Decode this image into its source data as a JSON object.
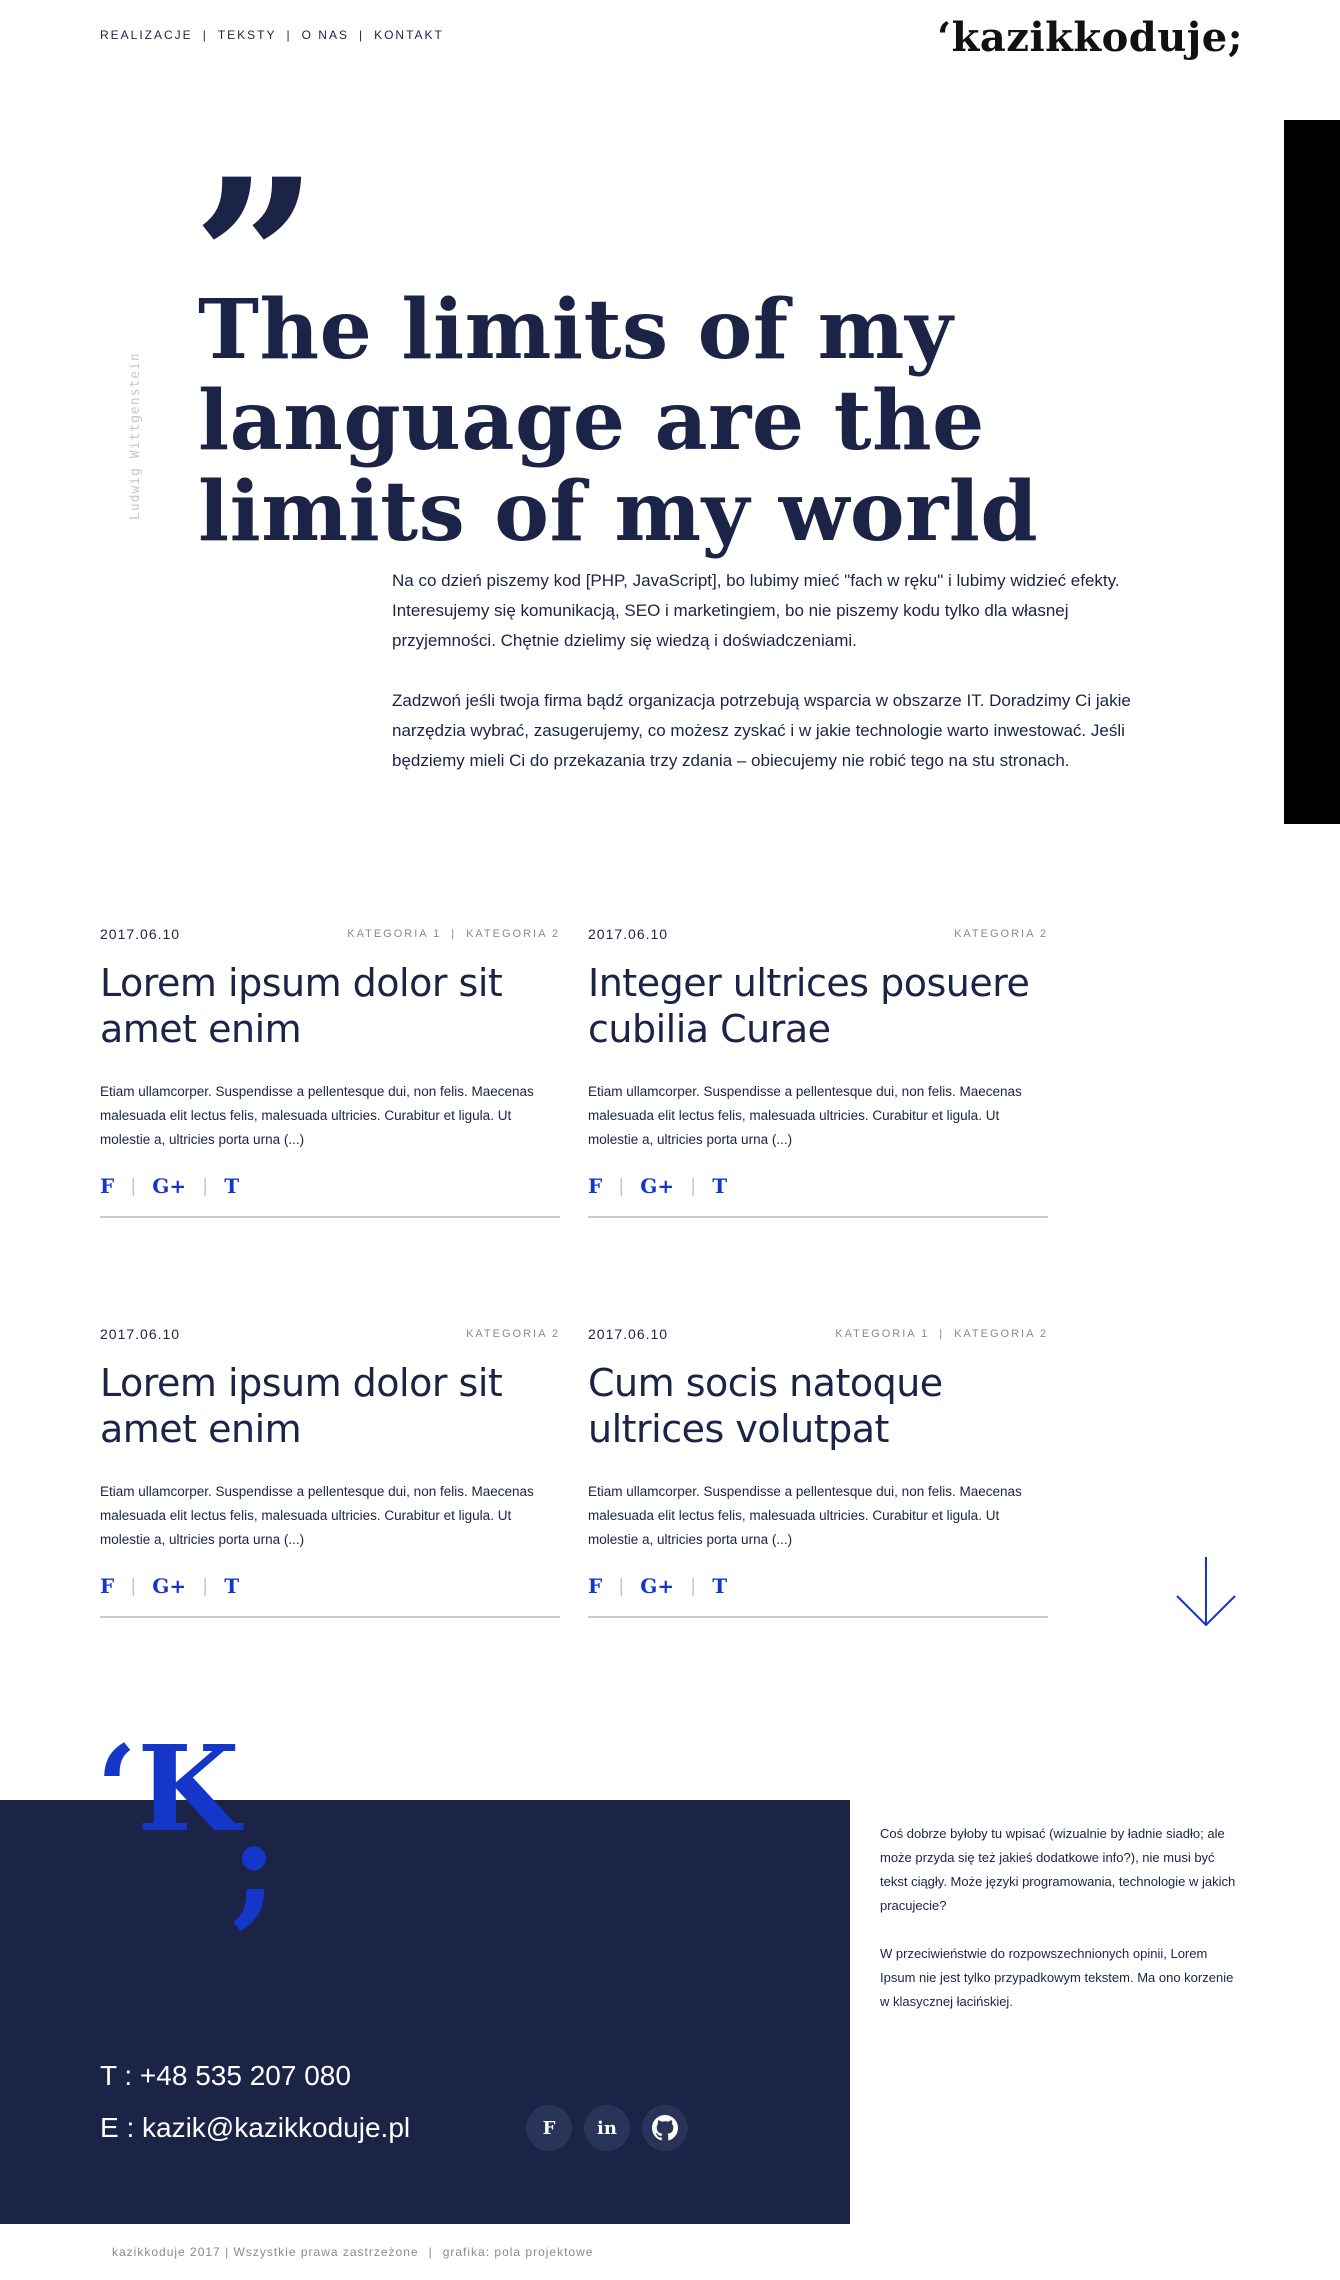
{
  "nav": {
    "items": [
      "REALIZACJE",
      "TEKSTY",
      "O NAS",
      "KONTAKT"
    ]
  },
  "logo": "‘kazikkoduje;",
  "hero": {
    "quote_mark": "”",
    "title": "The limits of my language are the limits of my world",
    "author": "Ludwig Wittgenstein",
    "paragraphs": [
      "Na co dzień piszemy kod [PHP, JavaScript], bo lubimy mieć \"fach w ręku\" i lubimy widzieć efekty. Interesujemy się komunikacją, SEO i marketingiem, bo nie piszemy kodu tylko dla własnej przyjemności. Chętnie dzielimy się wiedzą i doświadczeniami.",
      "Zadzwoń jeśli twoja firma bądź organizacja potrzebują wsparcia w obszarze IT. Doradzimy Ci jakie narzędzia wybrać, zasugerujemy, co możesz zyskać i w jakie technologie warto inwestować. Jeśli będziemy mieli Ci do przekazania trzy zdania – obiecujemy nie robić tego na stu stronach."
    ]
  },
  "articles": [
    {
      "date": "2017.06.10",
      "categories": [
        "KATEGORIA 1",
        "KATEGORIA 2"
      ],
      "title": "Lorem ipsum dolor sit amet enim",
      "excerpt": "Etiam ullamcorper. Suspendisse a pellentesque dui, non felis. Maecenas malesuada elit lectus felis, malesuada ultricies. Curabitur et ligula. Ut molestie a, ultricies porta urna (...)",
      "share": [
        "F",
        "G+",
        "T"
      ]
    },
    {
      "date": "2017.06.10",
      "categories": [
        "KATEGORIA 2"
      ],
      "title": "Integer ultrices posuere cubilia Curae",
      "excerpt": "Etiam ullamcorper. Suspendisse a pellentesque dui, non felis. Maecenas malesuada elit lectus felis, malesuada ultricies. Curabitur et ligula. Ut molestie a, ultricies porta urna (...)",
      "share": [
        "F",
        "G+",
        "T"
      ]
    },
    {
      "date": "2017.06.10",
      "categories": [
        "KATEGORIA 2"
      ],
      "title": "Lorem ipsum dolor sit amet enim",
      "excerpt": "Etiam ullamcorper. Suspendisse a pellentesque dui, non felis. Maecenas malesuada elit lectus felis, malesuada ultricies. Curabitur et ligula. Ut molestie a, ultricies porta urna (...)",
      "share": [
        "F",
        "G+",
        "T"
      ]
    },
    {
      "date": "2017.06.10",
      "categories": [
        "KATEGORIA 1",
        "KATEGORIA 2"
      ],
      "title": "Cum socis natoque ultrices volutpat",
      "excerpt": "Etiam ullamcorper. Suspendisse a pellentesque dui, non felis. Maecenas malesuada elit lectus felis, malesuada ultricies. Curabitur et ligula. Ut molestie a, ultricies porta urna (...)",
      "share": [
        "F",
        "G+",
        "T"
      ]
    }
  ],
  "footer": {
    "big_k": "‘K",
    "big_semicolon": ";",
    "phone": "T : +48 535 207 080",
    "email": "E : kazik@kazikkoduje.pl",
    "social": [
      {
        "label": "F",
        "icon": "facebook-icon"
      },
      {
        "label": "in",
        "icon": "linkedin-icon"
      },
      {
        "label": "",
        "icon": "github-icon"
      }
    ],
    "text_paragraphs": [
      "Coś dobrze byłoby tu wpisać (wizualnie by ładnie siadło; ale może przyda się też jakieś dodatkowe info?), nie musi być tekst ciągły. Może języki programowania, technologie w jakich pracujecie?",
      "W przeciwieństwie do rozpowszechnionych opinii, Lorem Ipsum nie jest tylko przypadkowym tekstem. Ma ono korzenie w klasycznej łacińskiej."
    ],
    "copyright": [
      "kazikkoduje 2017 |  Wszystkie prawa zastrzeżone",
      "grafika: pola projektowe"
    ]
  },
  "colors": {
    "navy": "#1b2346",
    "accent_blue": "#1537c9",
    "black_bar": "#000000"
  }
}
